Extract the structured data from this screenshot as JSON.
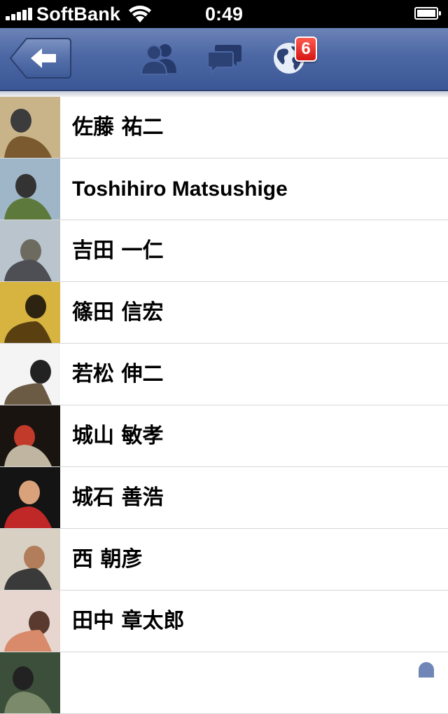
{
  "status_bar": {
    "carrier": "SoftBank",
    "time": "0:49"
  },
  "nav": {
    "back_icon": "back-arrow-icon",
    "friends_icon": "friend-requests-icon",
    "messages_icon": "messages-icon",
    "notifications_icon": "notifications-globe-icon",
    "notification_count": "6",
    "colors": {
      "nav_top": "#6b83b7",
      "nav_bottom": "#3b5795",
      "badge": "#e0241c"
    }
  },
  "friends": [
    {
      "name": "佐藤 祐二",
      "avatar_colors": [
        "#c9b48a",
        "#7a5a2e",
        "#3c3c3c"
      ]
    },
    {
      "name": "Toshihiro Matsushige",
      "avatar_colors": [
        "#9fb6c9",
        "#5d7a3c",
        "#333333"
      ]
    },
    {
      "name": "吉田 一仁",
      "avatar_colors": [
        "#b9c4cc",
        "#4d4f55",
        "#6d6b60"
      ]
    },
    {
      "name": "篠田 信宏",
      "avatar_colors": [
        "#d7b340",
        "#5a4010",
        "#2c2410"
      ]
    },
    {
      "name": "若松 伸二",
      "avatar_colors": [
        "#f4f4f4",
        "#6b5a44",
        "#222222"
      ]
    },
    {
      "name": "城山 敏孝",
      "avatar_colors": [
        "#1a1410",
        "#bfb5a0",
        "#c23a2a"
      ]
    },
    {
      "name": "城石 善浩",
      "avatar_colors": [
        "#141414",
        "#c02828",
        "#d9a27a"
      ]
    },
    {
      "name": "西 朝彦",
      "avatar_colors": [
        "#d7d0c3",
        "#3a3a3a",
        "#b27d5a"
      ]
    },
    {
      "name": "田中 章太郎",
      "avatar_colors": [
        "#e7d6cf",
        "#d88a6a",
        "#5a3a2e"
      ]
    },
    {
      "name": "",
      "avatar_colors": [
        "#3c4f3a",
        "#7a8a6a",
        "#222222"
      ]
    }
  ]
}
